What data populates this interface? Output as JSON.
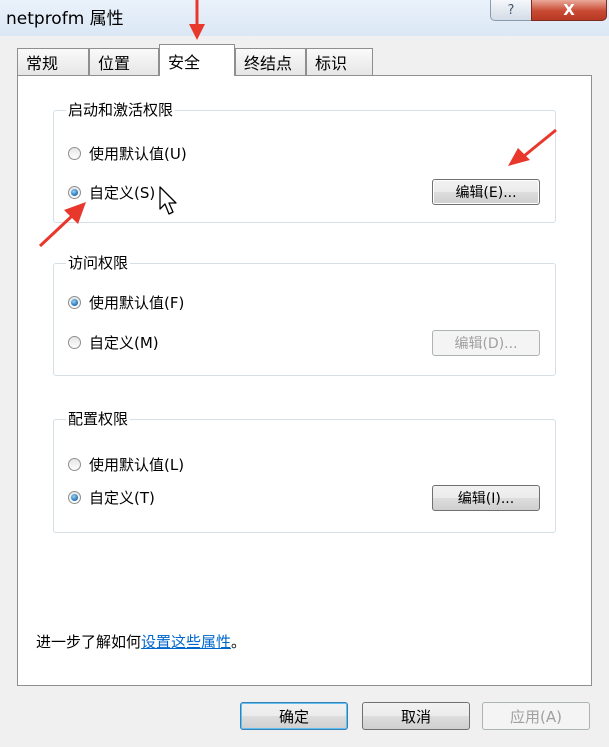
{
  "window": {
    "title": "netprofm 属性",
    "help_glyph": "?",
    "close_glyph": "X"
  },
  "tabs": [
    {
      "label": "常规",
      "active": false
    },
    {
      "label": "位置",
      "active": false
    },
    {
      "label": "安全",
      "active": true
    },
    {
      "label": "终结点",
      "active": false
    },
    {
      "label": "标识",
      "active": false
    }
  ],
  "launch_group": {
    "label": "启动和激活权限",
    "default_label": "使用默认值(U)",
    "custom_label": "自定义(S)",
    "selected": "custom",
    "edit_label": "编辑(E)...",
    "edit_enabled": true
  },
  "access_group": {
    "label": "访问权限",
    "default_label": "使用默认值(F)",
    "custom_label": "自定义(M)",
    "selected": "default",
    "edit_label": "编辑(D)...",
    "edit_enabled": false
  },
  "config_group": {
    "label": "配置权限",
    "default_label": "使用默认值(L)",
    "custom_label": "自定义(T)",
    "selected": "custom",
    "edit_label": "编辑(I)...",
    "edit_enabled": true
  },
  "learn_more": {
    "prefix": "进一步了解如何",
    "link": "设置这些属性",
    "suffix": "。"
  },
  "buttons": {
    "ok": "确定",
    "cancel": "取消",
    "apply": "应用(A)"
  },
  "colors": {
    "annotation_arrow": "#e8382c",
    "link": "#0066cc"
  }
}
